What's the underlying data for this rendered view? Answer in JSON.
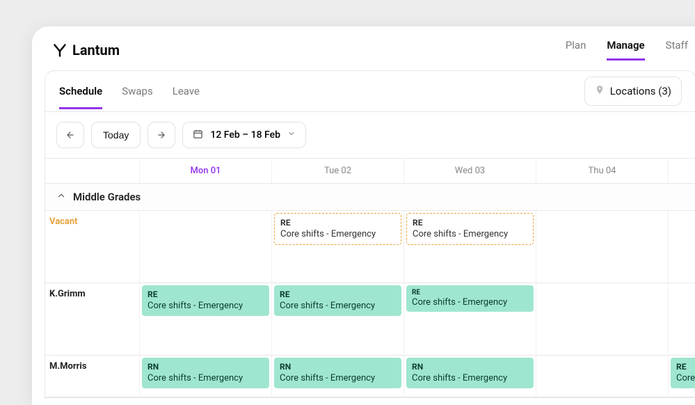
{
  "brand": {
    "name": "Lantum"
  },
  "topnav": {
    "items": [
      "Plan",
      "Manage",
      "Staff"
    ],
    "activeIndex": 1
  },
  "tabs": {
    "items": [
      "Schedule",
      "Swaps",
      "Leave"
    ],
    "activeIndex": 0
  },
  "filters": {
    "locations_label": "Locations (3)"
  },
  "toolbar": {
    "today_label": "Today",
    "date_range": "12 Feb – 18 Feb"
  },
  "days": [
    {
      "label": "Mon  01",
      "today": true
    },
    {
      "label": "Tue  02",
      "today": false
    },
    {
      "label": "Wed  03",
      "today": false
    },
    {
      "label": "Thu  04",
      "today": false
    },
    {
      "label": "",
      "today": false
    }
  ],
  "group": {
    "name": "Middle Grades"
  },
  "rows": [
    {
      "label": "Vacant",
      "vacant": true,
      "cells": [
        null,
        {
          "code": "RE",
          "desc": "Core shifts - Emergency",
          "style": "vacant"
        },
        {
          "code": "RE",
          "desc": "Core shifts - Emergency",
          "style": "vacant"
        },
        null,
        null
      ]
    },
    {
      "label": "K.Grimm",
      "vacant": false,
      "cells": [
        {
          "code": "RE",
          "desc": "Core shifts - Emergency",
          "style": "filled"
        },
        {
          "code": "RE",
          "desc": "Core shifts - Emergency",
          "style": "filled"
        },
        {
          "code": "RE",
          "desc": "Core shifts - Emergency",
          "style": "filled",
          "small": true
        },
        null,
        null
      ]
    },
    {
      "label": "M.Morris",
      "vacant": false,
      "cells": [
        {
          "code": "RN",
          "desc": "Core shifts - Emergency",
          "style": "filled"
        },
        {
          "code": "RN",
          "desc": "Core shifts - Emergency",
          "style": "filled"
        },
        {
          "code": "RN",
          "desc": "Core shifts - Emergency",
          "style": "filled"
        },
        null,
        {
          "code": "RE",
          "desc": "Core s",
          "style": "filled"
        }
      ]
    }
  ]
}
